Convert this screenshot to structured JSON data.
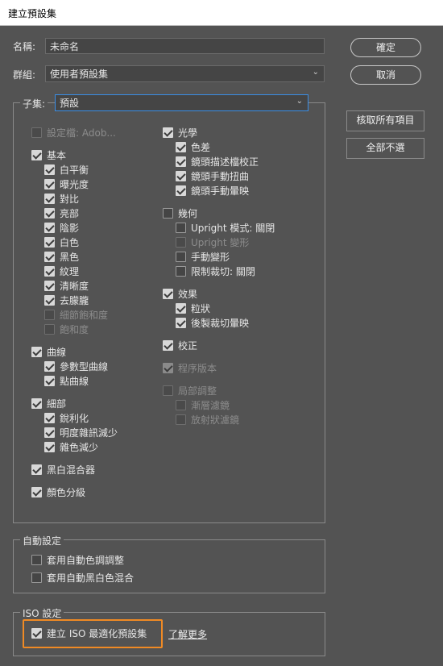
{
  "window": {
    "title": "建立預設集"
  },
  "name_row": {
    "label": "名稱:",
    "value": "未命名"
  },
  "group_row": {
    "label": "群組:",
    "value": "使用者預設集"
  },
  "buttons": {
    "ok": "確定",
    "cancel": "取消",
    "check_all": "核取所有項目",
    "check_none": "全部不選"
  },
  "subset": {
    "label": "子集:",
    "value": "預設",
    "left": [
      {
        "label": "設定檔: Adob...",
        "checked": false,
        "disabled": true,
        "indent": 0
      },
      {
        "label": "基本",
        "checked": true,
        "disabled": false,
        "indent": 0
      },
      {
        "label": "白平衡",
        "checked": true,
        "disabled": false,
        "indent": 1
      },
      {
        "label": "曝光度",
        "checked": true,
        "disabled": false,
        "indent": 1
      },
      {
        "label": "對比",
        "checked": true,
        "disabled": false,
        "indent": 1
      },
      {
        "label": "亮部",
        "checked": true,
        "disabled": false,
        "indent": 1
      },
      {
        "label": "陰影",
        "checked": true,
        "disabled": false,
        "indent": 1
      },
      {
        "label": "白色",
        "checked": true,
        "disabled": false,
        "indent": 1
      },
      {
        "label": "黑色",
        "checked": true,
        "disabled": false,
        "indent": 1
      },
      {
        "label": "紋理",
        "checked": true,
        "disabled": false,
        "indent": 1
      },
      {
        "label": "清晰度",
        "checked": true,
        "disabled": false,
        "indent": 1
      },
      {
        "label": "去朦朧",
        "checked": true,
        "disabled": false,
        "indent": 1
      },
      {
        "label": "細節飽和度",
        "checked": false,
        "disabled": true,
        "indent": 1
      },
      {
        "label": "飽和度",
        "checked": false,
        "disabled": true,
        "indent": 1
      },
      {
        "label": "曲線",
        "checked": true,
        "disabled": false,
        "indent": 0
      },
      {
        "label": "參數型曲線",
        "checked": true,
        "disabled": false,
        "indent": 1
      },
      {
        "label": "點曲線",
        "checked": true,
        "disabled": false,
        "indent": 1
      },
      {
        "label": "細部",
        "checked": true,
        "disabled": false,
        "indent": 0
      },
      {
        "label": "銳利化",
        "checked": true,
        "disabled": false,
        "indent": 1
      },
      {
        "label": "明度雜訊減少",
        "checked": true,
        "disabled": false,
        "indent": 1
      },
      {
        "label": "雜色減少",
        "checked": true,
        "disabled": false,
        "indent": 1
      },
      {
        "label": "黑白混合器",
        "checked": true,
        "disabled": false,
        "indent": 0
      },
      {
        "label": "顏色分級",
        "checked": true,
        "disabled": false,
        "indent": 0
      }
    ],
    "right": [
      {
        "label": "光學",
        "checked": true,
        "disabled": false,
        "indent": 0
      },
      {
        "label": "色差",
        "checked": true,
        "disabled": false,
        "indent": 1
      },
      {
        "label": "鏡頭描述檔校正",
        "checked": true,
        "disabled": false,
        "indent": 1
      },
      {
        "label": "鏡頭手動扭曲",
        "checked": true,
        "disabled": false,
        "indent": 1
      },
      {
        "label": "鏡頭手動暈映",
        "checked": true,
        "disabled": false,
        "indent": 1
      },
      {
        "label": "幾何",
        "checked": false,
        "disabled": false,
        "indent": 0
      },
      {
        "label": "Upright 模式: 關閉",
        "checked": false,
        "disabled": false,
        "indent": 1
      },
      {
        "label": "Upright 變形",
        "checked": false,
        "disabled": true,
        "indent": 1
      },
      {
        "label": "手動變形",
        "checked": false,
        "disabled": false,
        "indent": 1
      },
      {
        "label": "限制裁切: 關閉",
        "checked": false,
        "disabled": false,
        "indent": 1
      },
      {
        "label": "效果",
        "checked": true,
        "disabled": false,
        "indent": 0
      },
      {
        "label": "粒狀",
        "checked": true,
        "disabled": false,
        "indent": 1
      },
      {
        "label": "後製裁切暈映",
        "checked": true,
        "disabled": false,
        "indent": 1
      },
      {
        "label": "校正",
        "checked": true,
        "disabled": false,
        "indent": 0
      },
      {
        "label": "程序版本",
        "checked": true,
        "disabled": true,
        "indent": 0
      },
      {
        "label": "局部調整",
        "checked": false,
        "disabled": true,
        "indent": 0
      },
      {
        "label": "漸層濾鏡",
        "checked": false,
        "disabled": true,
        "indent": 1
      },
      {
        "label": "放射狀濾鏡",
        "checked": false,
        "disabled": true,
        "indent": 1
      }
    ]
  },
  "auto": {
    "label": "自動設定",
    "items": [
      {
        "label": "套用自動色調調整",
        "checked": false,
        "disabled": false
      },
      {
        "label": "套用自動黑白色混合",
        "checked": false,
        "disabled": false
      }
    ]
  },
  "iso": {
    "label": "ISO 設定",
    "item": {
      "label": "建立 ISO 最適化預設集",
      "checked": true,
      "disabled": false
    },
    "learn_more": "了解更多"
  }
}
